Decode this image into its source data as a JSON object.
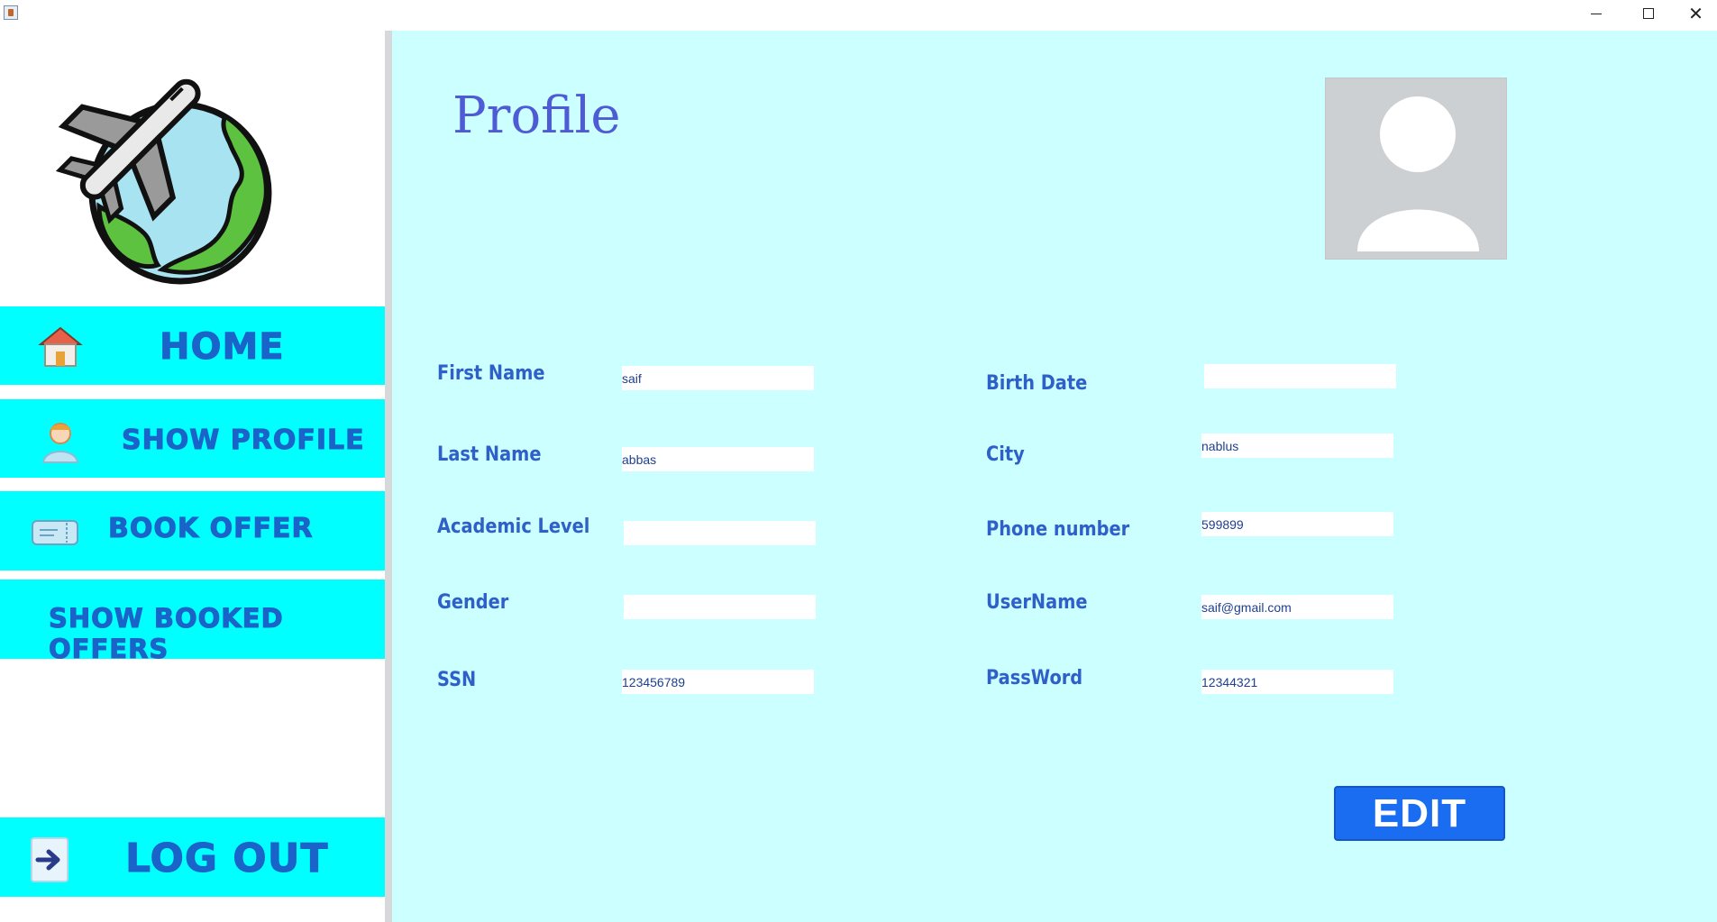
{
  "window": {
    "controls": {
      "minimize_icon": "minimize-icon",
      "maximize_icon": "maximize-icon",
      "close_icon": "close-icon"
    }
  },
  "sidebar": {
    "logo_icon": "airplane-globe-logo",
    "items": [
      {
        "label": "HOME",
        "icon": "house-icon"
      },
      {
        "label": "SHOW PROFILE",
        "icon": "user-icon"
      },
      {
        "label": "BOOK OFFER",
        "icon": "ticket-icon"
      },
      {
        "label": "SHOW BOOKED OFFERS",
        "icon": ""
      },
      {
        "label": "LOG OUT",
        "icon": "arrow-right-icon"
      }
    ]
  },
  "main": {
    "title": "Profile",
    "avatar_icon": "avatar-placeholder-icon",
    "fields_left": [
      {
        "label": "First Name",
        "value": "saif"
      },
      {
        "label": "Last Name",
        "value": "abbas"
      },
      {
        "label": "Academic Level",
        "value": ""
      },
      {
        "label": "Gender",
        "value": ""
      },
      {
        "label": "SSN",
        "value": "123456789"
      }
    ],
    "fields_right": [
      {
        "label": "Birth Date",
        "value": ""
      },
      {
        "label": "City",
        "value": "nablus"
      },
      {
        "label": "Phone number",
        "value": "599899"
      },
      {
        "label": "UserName",
        "value": "saif@gmail.com"
      },
      {
        "label": "PassWord",
        "value": "12344321"
      }
    ],
    "edit_label": "EDIT"
  },
  "colors": {
    "sidebar_button": "#00ffff",
    "nav_text": "#1a63c9",
    "main_background": "#ccffff",
    "label_text": "#2f5fc9",
    "title_text": "#4f5bd5",
    "edit_button": "#1a6cf0"
  }
}
